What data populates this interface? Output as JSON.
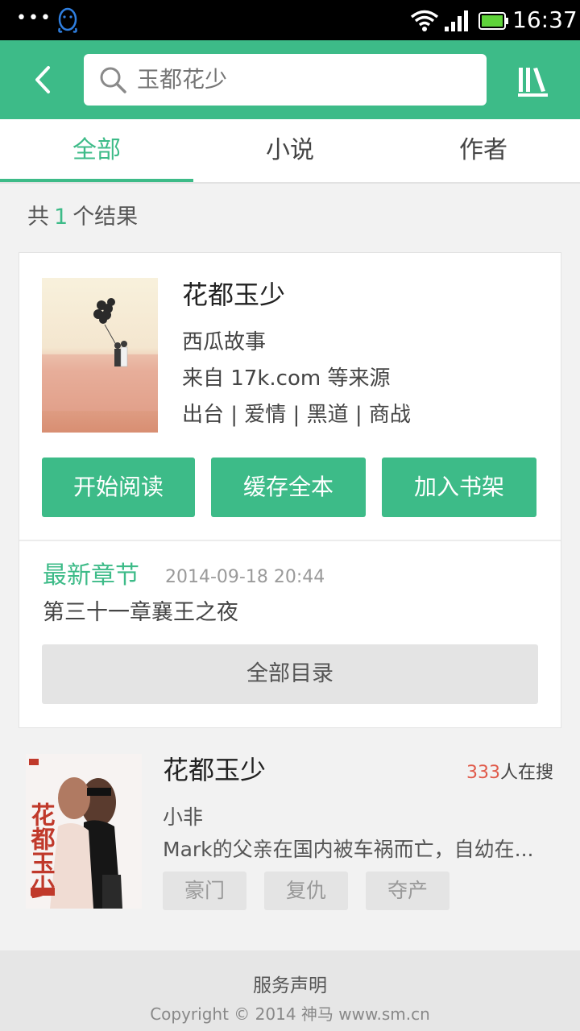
{
  "status_bar": {
    "dots": "•••",
    "time": "16:37",
    "icons": [
      "qq-icon",
      "wifi-icon",
      "signal-icon",
      "battery-icon"
    ]
  },
  "header": {
    "back_icon": "chevron-left-icon",
    "search_placeholder": "玉都花少",
    "search_icon": "search-icon",
    "bookshelf_icon": "bookshelf-icon"
  },
  "tabs": [
    {
      "label": "全部",
      "active": true
    },
    {
      "label": "小说",
      "active": false
    },
    {
      "label": "作者",
      "active": false
    }
  ],
  "result_count": {
    "prefix": "共",
    "count": "1",
    "suffix": "个结果"
  },
  "main_result": {
    "title": "花都玉少",
    "author": "西瓜故事",
    "source": "来自 17k.com 等来源",
    "tags": "出台 | 爱情 | 黑道 | 商战",
    "actions": [
      "开始阅读",
      "缓存全本",
      "加入书架"
    ],
    "latest_label": "最新章节",
    "latest_time": "2014-09-18 20:44",
    "latest_chapter": "第三十一章襄王之夜",
    "toc_label": "全部目录"
  },
  "second_result": {
    "title": "花都玉少",
    "heat_count": "333",
    "heat_suffix": "人在搜",
    "author": "小非",
    "description": "Mark的父亲在国内被车祸而亡，自幼在...",
    "tags": [
      "豪门",
      "复仇",
      "夺产"
    ],
    "cover_text": "花都玉少"
  },
  "footer": {
    "link": "服务声明",
    "copyright": "Copyright © 2014 神马 www.sm.cn"
  },
  "colors": {
    "accent": "#3dbb88",
    "heat": "#e05a4a"
  }
}
